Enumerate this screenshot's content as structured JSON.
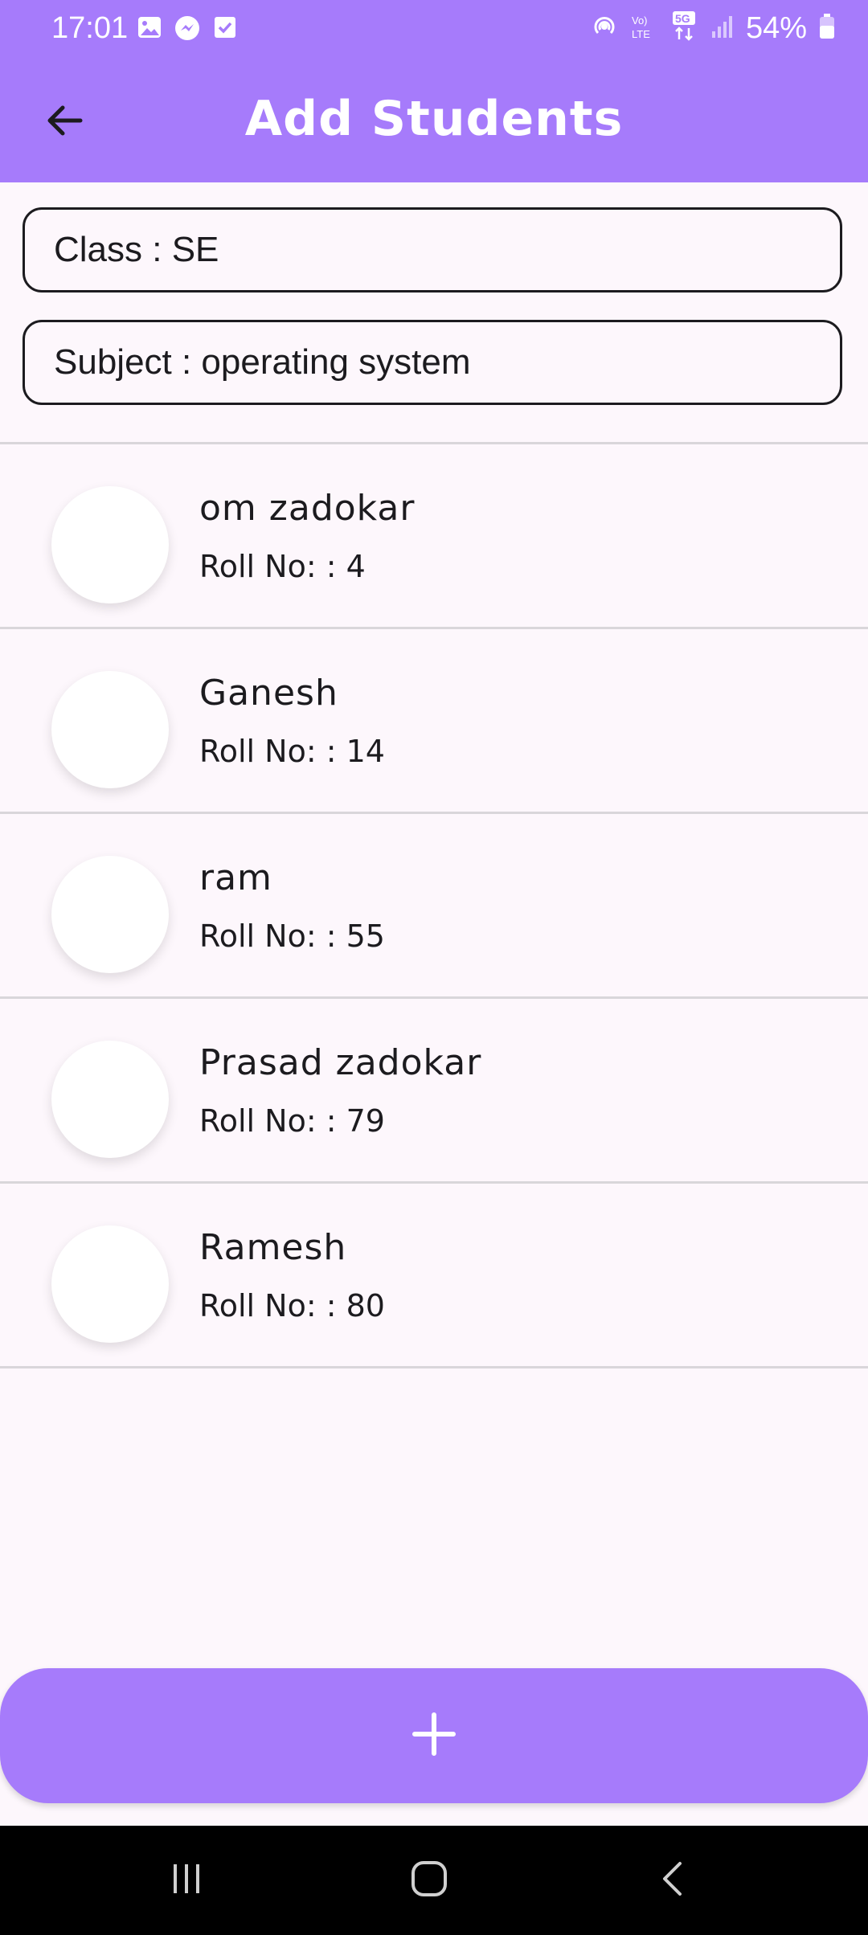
{
  "status_bar": {
    "time": "17:01",
    "battery": "54%",
    "left_icons": [
      "image-icon",
      "messenger-icon",
      "checkbox-icon"
    ],
    "right_icons": [
      "hotspot-icon",
      "volte-icon",
      "5g-icon",
      "signal-icon",
      "battery-icon"
    ]
  },
  "app_bar": {
    "title": "Add Students",
    "back_icon": "arrow-back-icon"
  },
  "info": {
    "class_text": "Class : SE",
    "subject_text": "Subject : operating system"
  },
  "students": [
    {
      "name": "om zadokar",
      "roll": "Roll No: : 4"
    },
    {
      "name": "Ganesh",
      "roll": "Roll No: : 14"
    },
    {
      "name": "ram",
      "roll": "Roll No: : 55"
    },
    {
      "name": "Prasad zadokar",
      "roll": "Roll No: : 79"
    },
    {
      "name": "Ramesh",
      "roll": "Roll No: : 80"
    }
  ],
  "fab": {
    "icon": "plus-icon"
  },
  "nav": {
    "icons": [
      "recents-icon",
      "home-icon",
      "back-icon"
    ]
  },
  "colors": {
    "accent": "#a67bfb",
    "background": "#fdf7fc",
    "text": "#1c1b1f",
    "divider": "#d9d6da",
    "nav_bar": "#000000"
  }
}
